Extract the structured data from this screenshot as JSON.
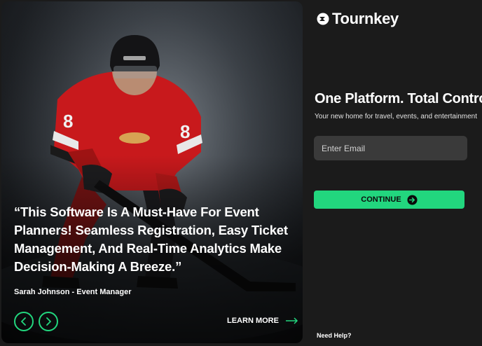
{
  "brand": {
    "name": "Tournkey"
  },
  "hero": {
    "quote": "“This Software Is A Must-Have For Event Planners! Seamless Registration, Easy Ticket Management, And Real-Time Analytics Make Decision-Making A Breeze.”",
    "author": "Sarah Johnson - Event Manager",
    "learn_more": "LEARN MORE"
  },
  "login": {
    "headline": "One Platform. Total Control",
    "subline": "Your new home for travel, events, and entertainment",
    "email_placeholder": "Enter Email",
    "continue_label": "CONTINUE",
    "help_label": "Need Help?"
  },
  "colors": {
    "accent": "#22d67e",
    "panel": "#1b1b1b",
    "input": "#3a3a3a"
  },
  "icons": [
    "tournkey-logo-icon",
    "chevron-left-icon",
    "chevron-right-icon",
    "arrow-right-icon",
    "arrow-circle-right-icon"
  ]
}
